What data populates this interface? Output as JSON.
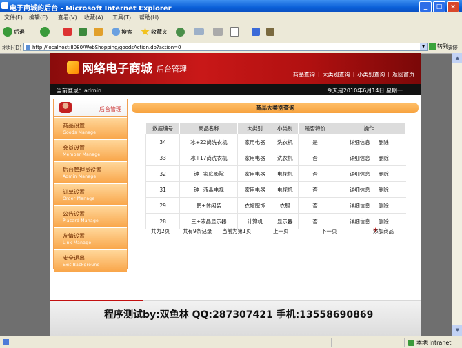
{
  "window": {
    "title": "电子商城的后台 - Microsoft Internet Explorer"
  },
  "menu": [
    "文件(F)",
    "编辑(E)",
    "查看(V)",
    "收藏(A)",
    "工具(T)",
    "帮助(H)"
  ],
  "toolbar": {
    "back": "后退",
    "search": "搜索",
    "favorites": "收藏夹"
  },
  "address": {
    "label": "地址(D)",
    "url": "http://localhost:8080/WebShopping/goodsAction.do?action=0",
    "go": "转到",
    "links": "链接"
  },
  "header": {
    "logo_name": "网络电子商城",
    "logo_sub": "后台管理",
    "nav": [
      "商品查询",
      "大类别查询",
      "小类别查询",
      "返回首页"
    ]
  },
  "infobar": {
    "login": "当前登录：admin",
    "date": "今天是2010年6月14日 星期一"
  },
  "sidebar": {
    "title": "后台管理",
    "items": [
      {
        "zh": "商品设置",
        "en": "Goods Manage"
      },
      {
        "zh": "会员设置",
        "en": "Member Manage"
      },
      {
        "zh": "后台管理员设置",
        "en": "Admin Manage"
      },
      {
        "zh": "订单设置",
        "en": "Order Manage"
      },
      {
        "zh": "公告设置",
        "en": "Placard Manage"
      },
      {
        "zh": "友情设置",
        "en": "Link Manage"
      },
      {
        "zh": "安全退出",
        "en": "Exit Background"
      }
    ]
  },
  "content": {
    "title": "商品大类别查询",
    "columns": [
      "数据编号",
      "商品名称",
      "大类别",
      "小类别",
      "是否特价",
      "操作"
    ],
    "rows": [
      [
        "34",
        "冰+22尚洗衣机",
        "家用电器",
        "洗衣机",
        "是"
      ],
      [
        "33",
        "冰+17尚洗衣机",
        "家用电器",
        "洗衣机",
        "否"
      ],
      [
        "32",
        "钟+家庭影院",
        "家用电器",
        "电视机",
        "否"
      ],
      [
        "31",
        "钟+液晶电视",
        "家用电器",
        "电视机",
        "否"
      ],
      [
        "29",
        "鹏+休闲装",
        "衣帽服饰",
        "衣服",
        "否"
      ],
      [
        "28",
        "三+液晶显示器",
        "计算机",
        "显示器",
        "否"
      ]
    ],
    "op_detail": "详细信息",
    "op_delete": "删除",
    "pager": {
      "total_pages": "共为2页",
      "total_records": "共有9条记录",
      "current": "当前为第1页",
      "prev": "上一页",
      "next": "下一页",
      "add": "添加商品"
    }
  },
  "footer": {
    "credit": "程序测试by:双鱼林 QQ:287307421 手机:13558690869"
  },
  "status": {
    "zone": "本地 Intranet"
  }
}
